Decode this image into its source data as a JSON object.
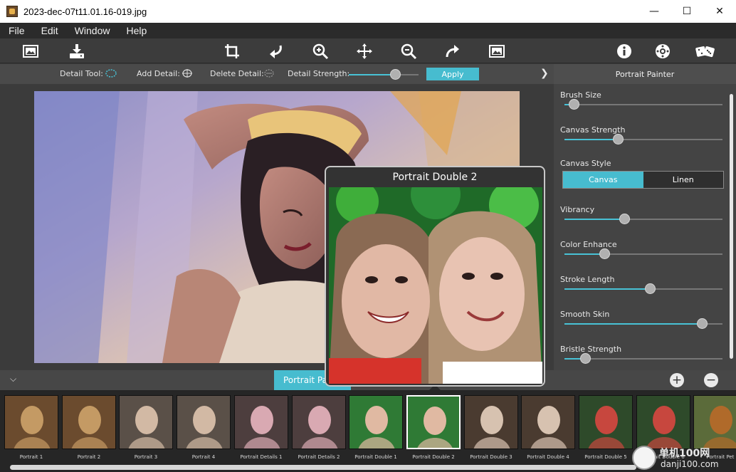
{
  "window": {
    "title": "2023-dec-07t11.01.16-019.jpg",
    "controls": [
      "—",
      "☐",
      "✕"
    ]
  },
  "menu": [
    "File",
    "Edit",
    "Window",
    "Help"
  ],
  "toolbar": {
    "icons": [
      "open-image-icon",
      "save-icon",
      "crop-icon",
      "undo-icon",
      "zoom-in-icon",
      "move-icon",
      "zoom-out-icon",
      "redo-icon",
      "fit-image-icon",
      "info-icon",
      "settings-icon",
      "randomize-dice-icon"
    ]
  },
  "detail": {
    "tool_label": "Detail Tool:",
    "add_label": "Add Detail:",
    "delete_label": "Delete Detail:",
    "strength_label": "Detail Strength:",
    "strength_value": 0.66,
    "apply_label": "Apply"
  },
  "panel": {
    "title": "Portrait Painter",
    "sliders": [
      {
        "label": "Brush Size",
        "value": 0.06
      },
      {
        "label": "Canvas Strength",
        "value": 0.34
      },
      {
        "label": "Vibrancy",
        "value": 0.38
      },
      {
        "label": "Color Enhance",
        "value": 0.25
      },
      {
        "label": "Stroke Length",
        "value": 0.54
      },
      {
        "label": "Smooth Skin",
        "value": 0.87
      },
      {
        "label": "Bristle Strength",
        "value": 0.13
      }
    ],
    "canvas_style": {
      "label": "Canvas Style",
      "options": [
        "Canvas",
        "Linen"
      ],
      "selected": "Canvas"
    }
  },
  "popup": {
    "title": "Portrait Double 2"
  },
  "collection": {
    "tab_label": "Portrait Painter",
    "add": "+",
    "remove": "−"
  },
  "thumbnails": [
    "Portrait 1",
    "Portrait 2",
    "Portrait 3",
    "Portrait 4",
    "Portrait Details 1",
    "Portrait Details 2",
    "Portrait Double 1",
    "Portrait Double 2",
    "Portrait Double 3",
    "Portrait Double 4",
    "Portrait Double 5",
    "Portrait Double 6",
    "Portrait Pet"
  ],
  "selected_thumbnail": "Portrait Double 2",
  "watermark": {
    "line1": "单机100网",
    "line2": "danji100.com"
  },
  "colors": {
    "accent": "#47bccf",
    "panel": "#444444",
    "toolbar": "#3c3c3c"
  }
}
